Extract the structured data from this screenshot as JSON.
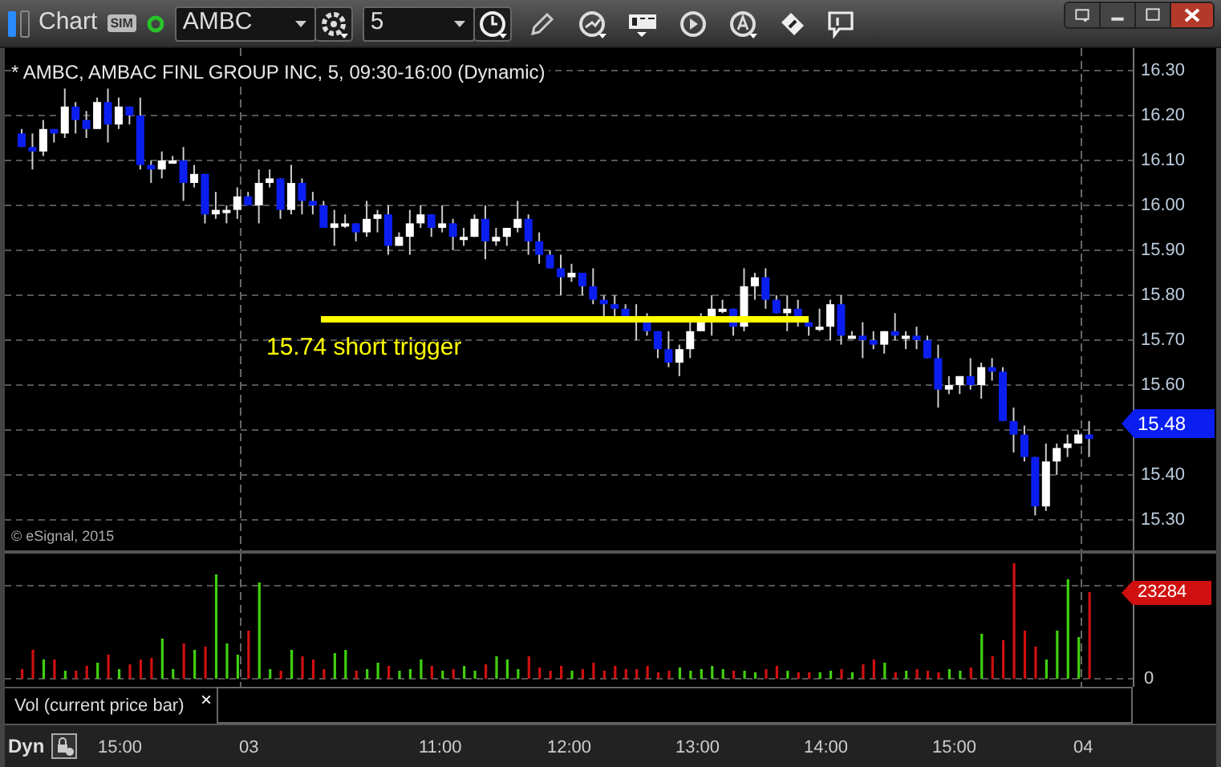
{
  "window": {
    "title": "Chart",
    "sim_badge": "SIM",
    "connected": true
  },
  "toolbar": {
    "symbol": "AMBC",
    "interval": "5"
  },
  "chart": {
    "legend": "* AMBC, AMBAC FINL GROUP INC, 5, 09:30-16:00 (Dynamic)",
    "price_labels": [
      "16.30",
      "16.20",
      "16.10",
      "16.00",
      "15.90",
      "15.80",
      "15.70",
      "15.60",
      "15.40",
      "15.30"
    ],
    "last_price": "15.48",
    "annotation": "15.74 short trigger",
    "copyright": "© eSignal, 2015"
  },
  "volume": {
    "last_volume": "23284",
    "zero_label": "0",
    "study_label": "Vol (current price bar)",
    "close_button": "×"
  },
  "time_axis": {
    "mode": "Dyn",
    "labels": [
      "15:00",
      "03",
      "11:00",
      "12:00",
      "13:00",
      "14:00",
      "15:00",
      "04"
    ]
  }
}
